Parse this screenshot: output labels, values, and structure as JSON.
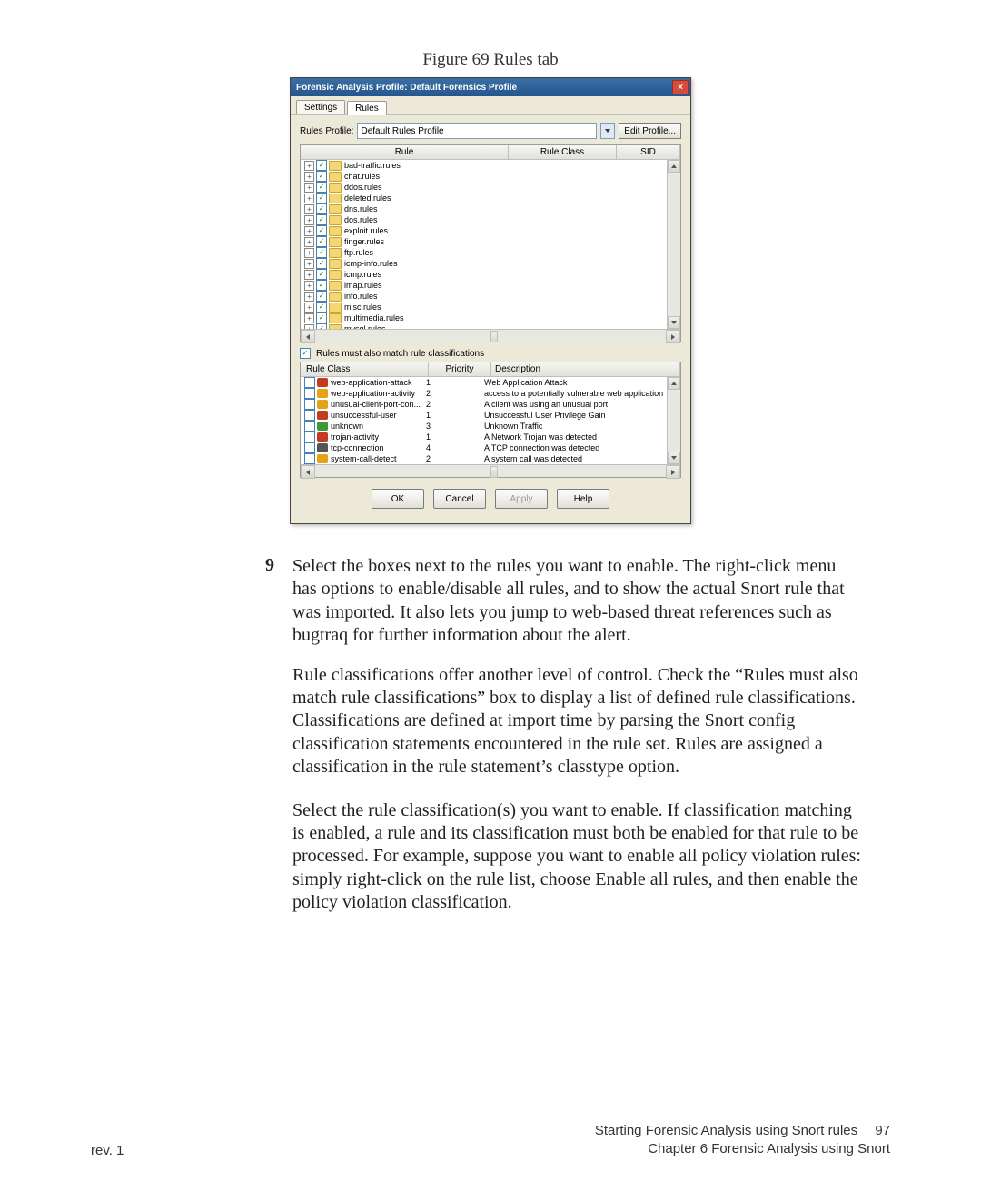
{
  "figure_caption": "Figure 69  Rules tab",
  "dialog": {
    "title": "Forensic Analysis Profile: Default Forensics Profile",
    "tabs": {
      "settings": "Settings",
      "rules": "Rules"
    },
    "profile_label": "Rules Profile:",
    "profile_value": "Default Rules Profile",
    "edit_profile": "Edit Profile...",
    "grid_headers": {
      "rule": "Rule",
      "class": "Rule Class",
      "sid": "SID"
    },
    "rules": [
      "bad-traffic.rules",
      "chat.rules",
      "ddos.rules",
      "deleted.rules",
      "dns.rules",
      "dos.rules",
      "exploit.rules",
      "finger.rules",
      "ftp.rules",
      "icmp-info.rules",
      "icmp.rules",
      "imap.rules",
      "info.rules",
      "misc.rules",
      "multimedia.rules",
      "mysql.rules"
    ],
    "must_match_label": "Rules must also match rule classifications",
    "class_headers": {
      "rule_class": "Rule Class",
      "priority": "Priority",
      "description": "Description"
    },
    "classifications": [
      {
        "name": "web-application-attack",
        "priority": "1",
        "desc": "Web Application Attack",
        "sev": "sev1"
      },
      {
        "name": "web-application-activity",
        "priority": "2",
        "desc": "access to a potentially vulnerable web application",
        "sev": "sev2"
      },
      {
        "name": "unusual-client-port-con...",
        "priority": "2",
        "desc": "A client was using an unusual port",
        "sev": "sev2"
      },
      {
        "name": "unsuccessful-user",
        "priority": "1",
        "desc": "Unsuccessful User Privilege Gain",
        "sev": "sev1"
      },
      {
        "name": "unknown",
        "priority": "3",
        "desc": "Unknown Traffic",
        "sev": "sev3"
      },
      {
        "name": "trojan-activity",
        "priority": "1",
        "desc": "A Network Trojan was detected",
        "sev": "sev1"
      },
      {
        "name": "tcp-connection",
        "priority": "4",
        "desc": "A TCP connection was detected",
        "sev": "sevd"
      },
      {
        "name": "system-call-detect",
        "priority": "2",
        "desc": "A system call was detected",
        "sev": "sev2"
      }
    ],
    "buttons": {
      "ok": "OK",
      "cancel": "Cancel",
      "apply": "Apply",
      "help": "Help"
    }
  },
  "step_number": "9",
  "paragraph_1": "Select the boxes next to the rules you want to enable. The right-click menu has options to enable/disable all rules, and to show the actual Snort rule that was imported. It also lets you jump to web-based threat references such as bugtraq for further information about the alert.",
  "paragraph_2": "Rule classifications offer another level of control. Check the “Rules must also match rule classifications” box to display a list of defined rule classifications. Classifications are defined at import time by parsing the Snort config classification statements encountered in the rule set. Rules are assigned a classification in the rule statement’s classtype option.",
  "paragraph_3": "Select the rule classification(s) you want to enable. If classification matching is enabled, a rule and its classification must both be enabled for that rule to be processed. For example, suppose you want to enable all policy violation rules: simply right-click on the rule list, choose Enable all rules, and then enable the policy violation classification.",
  "footer": {
    "rev": "rev. 1",
    "line1": "Starting Forensic Analysis using Snort rules",
    "page_num": "97",
    "line2": "Chapter 6 Forensic Analysis using Snort"
  }
}
